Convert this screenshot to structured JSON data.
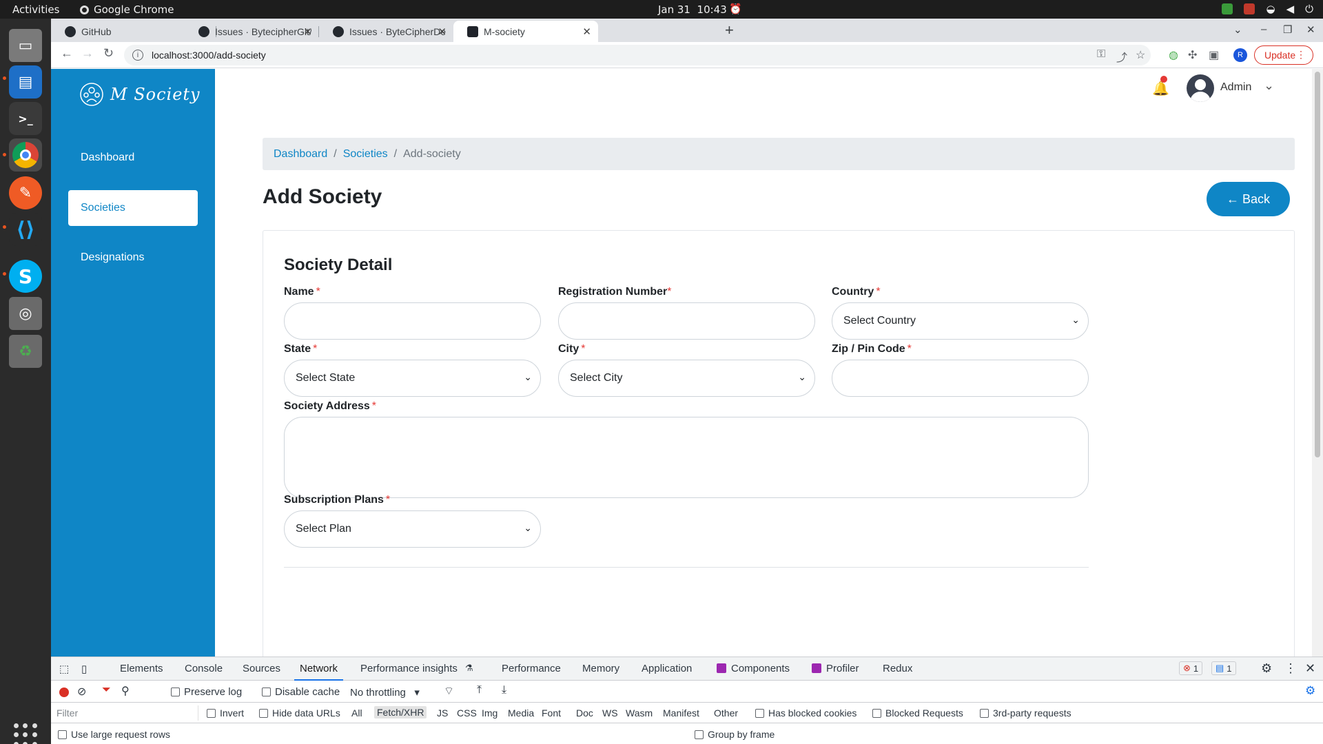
{
  "os": {
    "activities": "Activities",
    "app_name": "Google Chrome",
    "date": "Jan 31",
    "time": "10:43"
  },
  "browser": {
    "tabs": [
      {
        "label": "GitHub"
      },
      {
        "label": "Issues · BytecipherGit/M-S"
      },
      {
        "label": "Issues · ByteCipherDev/M"
      },
      {
        "label": "M-society"
      }
    ],
    "url": "localhost:3000/add-society",
    "profile_initial": "R",
    "update_label": "Update"
  },
  "app": {
    "logo_text": "M Society",
    "sidebar": {
      "items": [
        {
          "label": "Dashboard"
        },
        {
          "label": "Societies"
        },
        {
          "label": "Designations"
        }
      ]
    },
    "header": {
      "user_name": "Admin"
    },
    "breadcrumb": {
      "items": [
        "Dashboard",
        "Societies",
        "Add-society"
      ],
      "separator": "/"
    },
    "page_title": "Add Society",
    "back_label": "← Back",
    "form": {
      "section_title": "Society Detail",
      "fields": {
        "name": {
          "label": "Name",
          "value": ""
        },
        "registration": {
          "label": "Registration Number",
          "value": ""
        },
        "country": {
          "label": "Country",
          "selected": "Select Country"
        },
        "state": {
          "label": "State",
          "selected": "Select State"
        },
        "city": {
          "label": "City",
          "selected": "Select City"
        },
        "zip": {
          "label": "Zip / Pin Code",
          "value": ""
        },
        "address": {
          "label": "Society Address",
          "value": ""
        },
        "plans": {
          "label": "Subscription Plans",
          "selected": "Select Plan"
        }
      },
      "required_mark": "*"
    },
    "colors": {
      "primary": "#0f86c6",
      "required": "#e53935"
    }
  },
  "devtools": {
    "tabs": [
      "Elements",
      "Console",
      "Sources",
      "Network",
      "Performance insights",
      "Performance",
      "Memory",
      "Application",
      "Components",
      "Profiler",
      "Redux"
    ],
    "active_tab": "Network",
    "error_count": "1",
    "message_count": "1",
    "preserve_log": "Preserve log",
    "disable_cache": "Disable cache",
    "throttling": "No throttling",
    "filter_placeholder": "Filter",
    "invert": "Invert",
    "hide_data_urls": "Hide data URLs",
    "filter_types": [
      "All",
      "Fetch/XHR",
      "JS",
      "CSS",
      "Img",
      "Media",
      "Font",
      "Doc",
      "WS",
      "Wasm",
      "Manifest",
      "Other"
    ],
    "selected_filter": "Fetch/XHR",
    "has_blocked_cookies": "Has blocked cookies",
    "blocked_requests": "Blocked Requests",
    "third_party": "3rd-party requests",
    "large_rows": "Use large request rows",
    "group_by_frame": "Group by frame"
  }
}
